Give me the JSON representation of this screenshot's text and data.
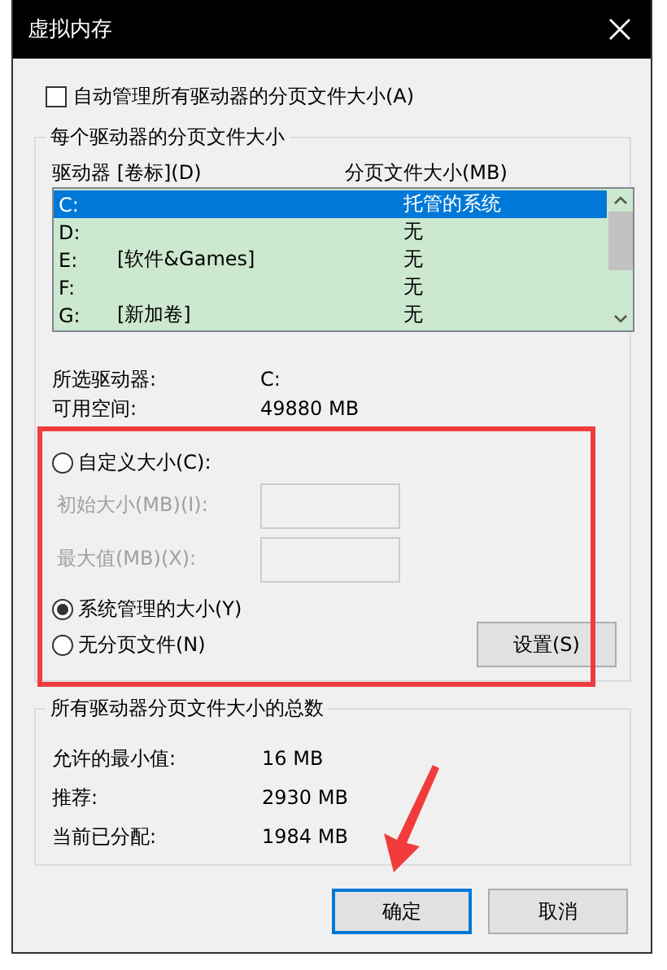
{
  "window": {
    "title": "虚拟内存"
  },
  "auto_manage": {
    "label": "自动管理所有驱动器的分页文件大小(A)",
    "checked": false
  },
  "per_drive": {
    "title": "每个驱动器的分页文件大小",
    "columns": [
      "驱动器 [卷标](D)",
      "分页文件大小(MB)"
    ],
    "drives": [
      {
        "drive": "C:",
        "size": "托管的系统",
        "selected": true
      },
      {
        "drive": "D:",
        "size": "无",
        "selected": false
      },
      {
        "drive": "E:",
        "label": "[软件&Games]",
        "size": "无",
        "selected": false
      },
      {
        "drive": "F:",
        "size": "无",
        "selected": false
      },
      {
        "drive": "G:",
        "label": "[新加卷]",
        "size": "无",
        "selected": false
      }
    ],
    "info": [
      {
        "label": "所选驱动器:",
        "value": "C:"
      },
      {
        "label": "可用空间:",
        "value": "49880 MB"
      }
    ],
    "size_options": [
      {
        "label": "自定义大小(C):",
        "selected": false
      },
      {
        "label": "系统管理的大小(Y)",
        "selected": true
      },
      {
        "label": "无分页文件(N)",
        "selected": false
      }
    ],
    "size_fields": [
      {
        "label": "初始大小(MB)(I):",
        "disabled": true
      },
      {
        "label": "最大值(MB)(X):",
        "disabled": true
      }
    ],
    "set_button": "设置(S)"
  },
  "totals": {
    "title": "所有驱动器分页文件大小的总数",
    "rows": [
      {
        "label": "允许的最小值:",
        "value": "16 MB"
      },
      {
        "label": "推荐:",
        "value": "2930 MB"
      },
      {
        "label": "当前已分配:",
        "value": "1984 MB"
      }
    ]
  },
  "buttons": [
    {
      "label": "确定",
      "focused": true
    },
    {
      "label": "取消",
      "focused": false
    }
  ]
}
